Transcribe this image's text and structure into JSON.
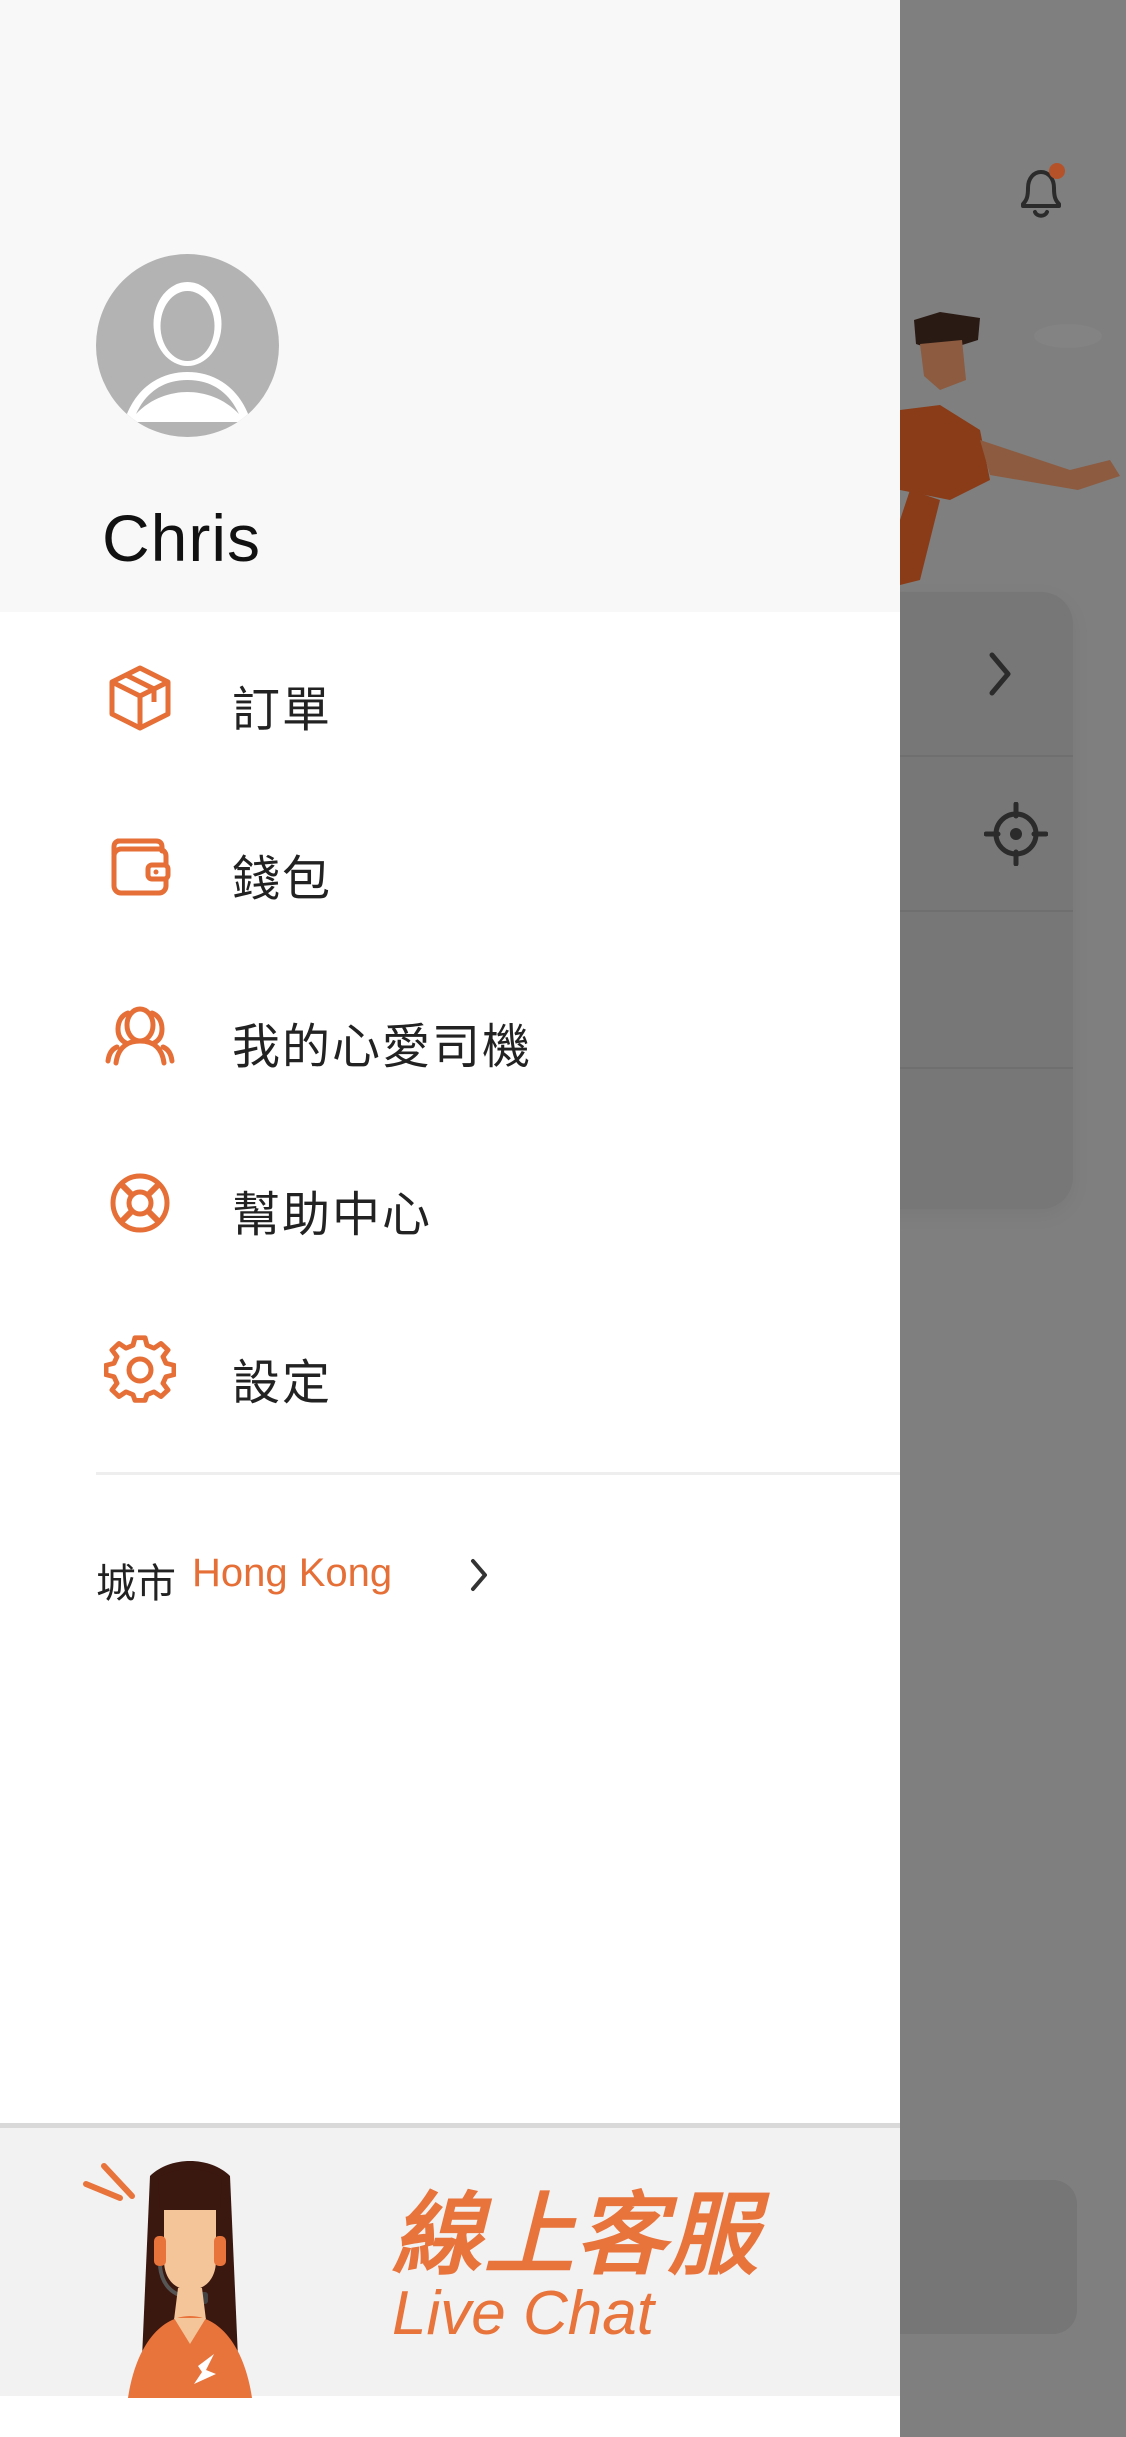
{
  "user": {
    "name": "Chris"
  },
  "menu": {
    "items": [
      {
        "label": "訂單",
        "icon": "package-icon"
      },
      {
        "label": "錢包",
        "icon": "wallet-icon"
      },
      {
        "label": "我的心愛司機",
        "icon": "favorite-drivers-icon"
      },
      {
        "label": "幫助中心",
        "icon": "lifebuoy-icon"
      },
      {
        "label": "設定",
        "icon": "gear-icon"
      }
    ]
  },
  "city": {
    "label": "城市",
    "value": "Hong Kong"
  },
  "live_chat": {
    "title_zh": "線上客服",
    "title_en": "Live Chat"
  },
  "colors": {
    "accent": "#e56f36",
    "overlay": "#7f7f7f",
    "drawer_header": "#f8f8f8"
  }
}
